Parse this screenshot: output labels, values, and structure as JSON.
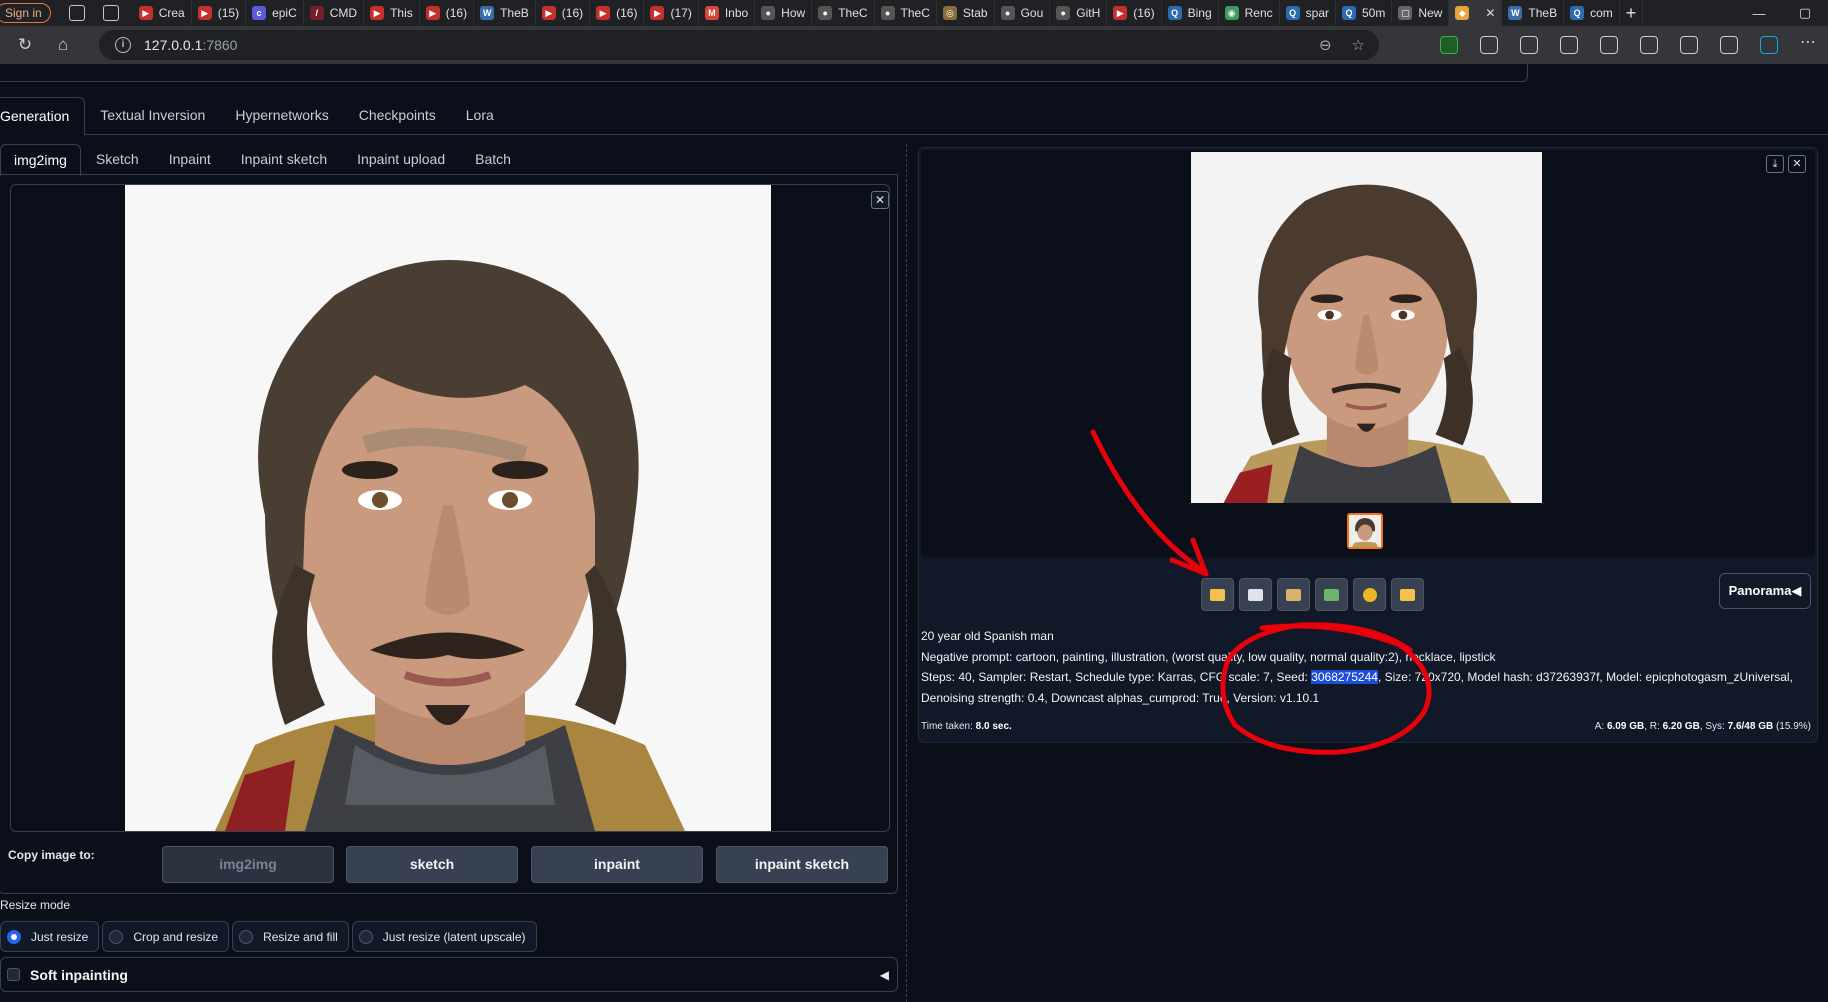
{
  "browser": {
    "signin": "Sign in",
    "tabs": [
      {
        "label": "Crea",
        "color": "#c4302b",
        "glyph": "▶"
      },
      {
        "label": "(15)",
        "color": "#c4302b",
        "glyph": "▶"
      },
      {
        "label": "epiC",
        "color": "#5b5bd6",
        "glyph": "c"
      },
      {
        "label": "CMD",
        "color": "#7a1d2b",
        "glyph": "/"
      },
      {
        "label": "This",
        "color": "#c4302b",
        "glyph": "▶"
      },
      {
        "label": "(16)",
        "color": "#c4302b",
        "glyph": "▶"
      },
      {
        "label": "TheB",
        "color": "#3b6ea8",
        "glyph": "W"
      },
      {
        "label": "(16)",
        "color": "#c4302b",
        "glyph": "▶"
      },
      {
        "label": "(16)",
        "color": "#c4302b",
        "glyph": "▶"
      },
      {
        "label": "(17)",
        "color": "#c4302b",
        "glyph": "▶"
      },
      {
        "label": "Inbo",
        "color": "#d44638",
        "glyph": "M"
      },
      {
        "label": "How",
        "color": "#555555",
        "glyph": "●"
      },
      {
        "label": "TheC",
        "color": "#555555",
        "glyph": "●"
      },
      {
        "label": "TheC",
        "color": "#555555",
        "glyph": "●"
      },
      {
        "label": "Stab",
        "color": "#8a6d3b",
        "glyph": "◎"
      },
      {
        "label": "Gou",
        "color": "#555555",
        "glyph": "●"
      },
      {
        "label": "GitH",
        "color": "#555555",
        "glyph": "●"
      },
      {
        "label": "(16)",
        "color": "#c4302b",
        "glyph": "▶"
      },
      {
        "label": "Bing",
        "color": "#2b6cb0",
        "glyph": "Q"
      },
      {
        "label": "Renc",
        "color": "#3a9d5d",
        "glyph": "◉"
      },
      {
        "label": "spar",
        "color": "#2b6cb0",
        "glyph": "Q"
      },
      {
        "label": "50m",
        "color": "#2b6cb0",
        "glyph": "Q"
      },
      {
        "label": "New",
        "color": "#666666",
        "glyph": "▢"
      },
      {
        "label": "",
        "color": "#e8a33a",
        "glyph": "◆",
        "active": true
      },
      {
        "label": "TheB",
        "color": "#3b6ea8",
        "glyph": "W"
      },
      {
        "label": "com",
        "color": "#2b6cb0",
        "glyph": "Q"
      }
    ],
    "url_host": "127.0.0.1",
    "url_port": ":7860",
    "new_tab_glyph": "+",
    "win_minimize": "—",
    "win_restore": "▢"
  },
  "main_tabs": [
    "Generation",
    "Textual Inversion",
    "Hypernetworks",
    "Checkpoints",
    "Lora"
  ],
  "sub_tabs": [
    "img2img",
    "Sketch",
    "Inpaint",
    "Inpaint sketch",
    "Inpaint upload",
    "Batch"
  ],
  "copy": {
    "label": "Copy image to:",
    "buttons": [
      "img2img",
      "sketch",
      "inpaint",
      "inpaint sketch"
    ]
  },
  "resize": {
    "label": "Resize mode",
    "options": [
      "Just resize",
      "Crop and resize",
      "Resize and fill",
      "Just resize (latent upscale)"
    ],
    "selected": "Just resize"
  },
  "soft_inpainting": "Soft inpainting",
  "output": {
    "panorama": "Panorama◀",
    "prompt": "20 year old Spanish man",
    "negative_prefix": "Negative prompt: ",
    "negative": "cartoon, painting, illustration, (worst quality, low quality, normal quality:2), necklace, lipstick",
    "params_prefix": "Steps: 40, Sampler: Restart, Schedule type: Karras, CFG scale: 7, Seed: ",
    "seed": "3068275244",
    "params_suffix": ", Size: 720x720, Model hash: d37263937f, Model: epicphotogasm_zUniversal, Denoising strength: 0.4, Downcast alphas_cumprod: True, Version: v1.10.1",
    "time_label": "Time taken: ",
    "time_value": "8.0 sec.",
    "mem_a_label": "A: ",
    "mem_a": "6.09 GB",
    "mem_r_label": ", R: ",
    "mem_r": "6.20 GB",
    "mem_sys_label": ", Sys: ",
    "mem_sys": "7.6/48 GB",
    "mem_pct": " (15.9%)"
  },
  "tools": [
    {
      "name": "folder-icon",
      "color": "#f2c14e"
    },
    {
      "name": "save-icon",
      "color": "#dfe3ea"
    },
    {
      "name": "zip-icon",
      "color": "#d9b36c"
    },
    {
      "name": "image-icon",
      "color": "#6fb36a"
    },
    {
      "name": "palette-icon",
      "color": "#f0b429"
    },
    {
      "name": "ruler-icon",
      "color": "#f2c14e"
    }
  ],
  "colors": {
    "accent_orange": "#f97316",
    "seed_highlight": "#1d4ed8",
    "annotation_red": "#e8000b"
  }
}
